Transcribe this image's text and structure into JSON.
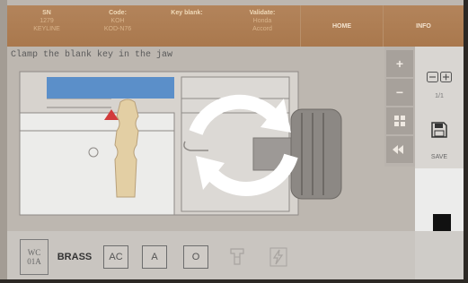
{
  "header": {
    "columns": [
      {
        "label": "SN",
        "values": [
          "1279",
          "KEYLINE"
        ]
      },
      {
        "label": "Code:",
        "values": [
          "KOH",
          "KOD-N76"
        ]
      },
      {
        "label": "Key blank:",
        "values": []
      },
      {
        "label": "Validate:",
        "values": [
          "Honda",
          "Accord"
        ]
      }
    ],
    "home_label": "HOME",
    "info_label": "INFO"
  },
  "message": "Clamp the blank key in the jaw",
  "zoom": {
    "plus": "+",
    "minus": "−"
  },
  "right_panel": {
    "page_indicator": "1/1",
    "save_label": "SAVE"
  },
  "bottom_bar": {
    "wc_label_top": "WC",
    "wc_label_bottom": "01A",
    "material_label": "BRASS",
    "ac_label": "AC",
    "a_label": "A",
    "o_label": "O"
  },
  "colors": {
    "header_bg": "#ad7e53",
    "accent_blue": "#5b8fc9",
    "marker_red": "#d23b3b",
    "key_blank": "#e3cfa4"
  },
  "icons": {
    "rotate": "rotate-arrows-icon",
    "save": "floppy-disk-icon",
    "stop": "stop-square-icon",
    "grid": "grid-icon",
    "cutter": "cutter-icon",
    "lightning": "lightning-icon"
  }
}
